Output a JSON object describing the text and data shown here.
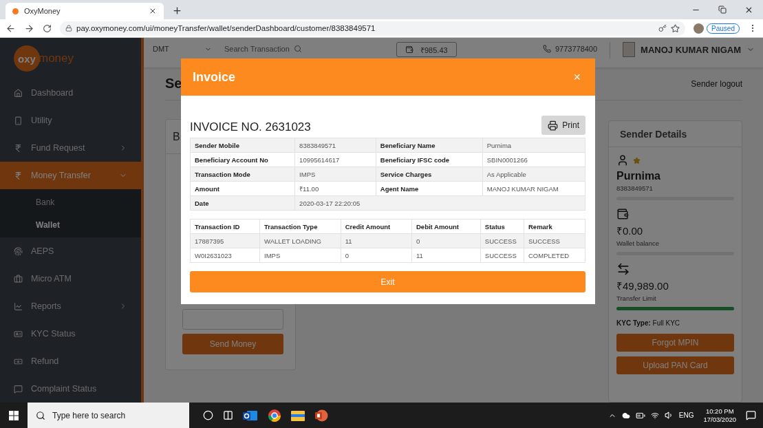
{
  "browser": {
    "tab_title": "OxyMoney",
    "url": "pay.oxymoney.com/ui/moneyTransfer/wallet/senderDashboard/customer/8383849571",
    "profile_status": "Paused"
  },
  "sidebar": {
    "logo": {
      "badge": "oxy",
      "rest": "money"
    },
    "items": [
      {
        "label": "Dashboard",
        "selected": false
      },
      {
        "label": "Utility",
        "selected": false
      },
      {
        "label": "Fund Request",
        "selected": false,
        "expanded": false
      },
      {
        "label": "Money Transfer",
        "selected": true,
        "expanded": true,
        "children": [
          {
            "label": "Bank",
            "selected": false
          },
          {
            "label": "Wallet",
            "selected": true
          }
        ]
      },
      {
        "label": "AEPS",
        "selected": false
      },
      {
        "label": "Micro ATM",
        "selected": false
      },
      {
        "label": "Reports",
        "selected": false,
        "expanded": false
      },
      {
        "label": "KYC Status",
        "selected": false
      },
      {
        "label": "Refund",
        "selected": false
      },
      {
        "label": "Complaint Status",
        "selected": false
      }
    ]
  },
  "header": {
    "service": "DMT",
    "search_placeholder": "Search Transaction",
    "balance": "₹985.43",
    "phone": "9773778400",
    "user_name": "MANOJ KUMAR NIGAM"
  },
  "page": {
    "title": "Se",
    "logout": "Sender logout",
    "card_heading": "B",
    "send_button": "Send Money"
  },
  "sender_details": {
    "title": "Sender Details",
    "name": "Purnima",
    "mobile": "8383849571",
    "wallet_amount": "₹0.00",
    "wallet_label": "Wallet balance",
    "limit_amount": "₹49,989.00",
    "limit_label": "Transfer Limit",
    "limit_bar": {
      "level": 1
    },
    "kyc_label": "KYC Type:",
    "kyc_value": "Full KYC",
    "buttons": [
      "Forgot MPIN",
      "Upload PAN Card"
    ]
  },
  "modal": {
    "title": "Invoice",
    "close": "×",
    "invoice_no": "INVOICE NO. 2631023",
    "print": "Print",
    "details": [
      {
        "cells": [
          "Sender Mobile",
          "8383849571",
          "Beneficiary Name",
          "Purnima"
        ]
      },
      {
        "cells": [
          "Beneficiary Account No",
          "10995614617",
          "Beneficiary IFSC code",
          "SBIN0001266"
        ]
      },
      {
        "cells": [
          "Transaction Mode",
          "IMPS",
          "Service Charges",
          "As Applicable"
        ]
      },
      {
        "cells": [
          "Amount",
          "₹11.00",
          "Agent Name",
          "MANOJ KUMAR NIGAM"
        ]
      },
      {
        "cells": [
          "Date",
          "2020-03-17 22:20:05"
        ]
      }
    ],
    "transactions": {
      "columns": [
        "Transaction ID",
        "Transaction Type",
        "Credit Amount",
        "Debit Amount",
        "Status",
        "Remark"
      ],
      "rows": [
        [
          "17887395",
          "WALLET LOADING",
          "11",
          "0",
          "SUCCESS",
          "SUCCESS"
        ],
        [
          "W0I2631023",
          "IMPS",
          "0",
          "11",
          "SUCCESS",
          "COMPLETED"
        ]
      ]
    },
    "exit": "Exit"
  },
  "taskbar": {
    "search_placeholder": "Type here to search",
    "language": "ENG",
    "time": "10:20 PM",
    "date": "17/03/2020"
  }
}
